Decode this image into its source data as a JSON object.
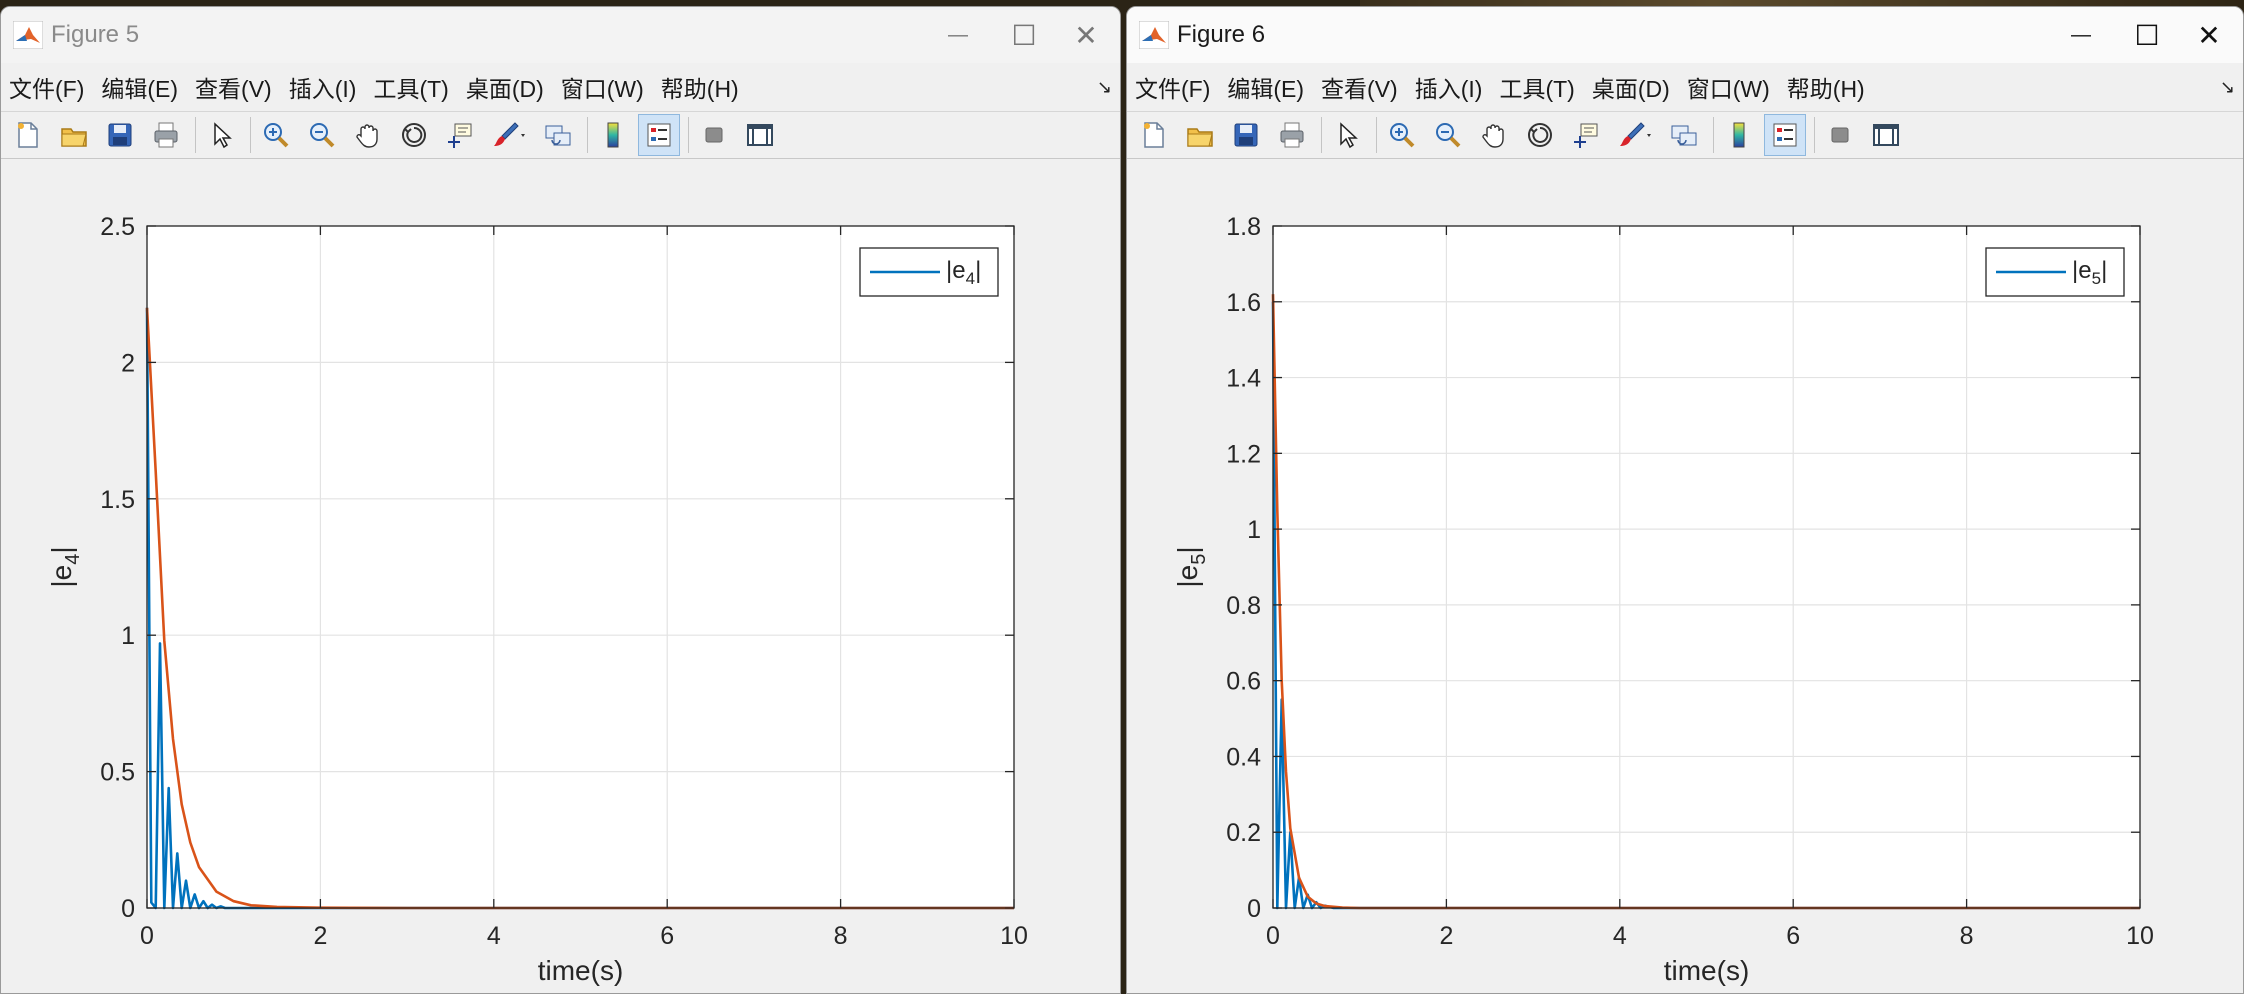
{
  "windows": [
    {
      "title": "Figure 5",
      "active": false,
      "menu": [
        "文件(F)",
        "编辑(E)",
        "查看(V)",
        "插入(I)",
        "工具(T)",
        "桌面(D)",
        "窗口(W)",
        "帮助(H)"
      ],
      "chart_data": {
        "type": "line",
        "xlabel": "time(s)",
        "ylabel_base": "|e",
        "ylabel_sub": "4",
        "ylabel_end": "|",
        "xlim": [
          0,
          10
        ],
        "ylim": [
          0,
          2.5
        ],
        "xticks": [
          0,
          2,
          4,
          6,
          8,
          10
        ],
        "yticks": [
          0,
          0.5,
          1,
          1.5,
          2,
          2.5
        ],
        "ytick_labels": [
          "0",
          "0.5",
          "1",
          "1.5",
          "2",
          "2.5"
        ],
        "grid": true,
        "legend": {
          "placement": "top-right",
          "base": "|e",
          "sub": "4",
          "end": "|"
        },
        "series": [
          {
            "legend_name": "|e4|",
            "color": "#0072BD",
            "kind": "oscillating-decay",
            "x": [
              0,
              0.05,
              0.1,
              0.15,
              0.2,
              0.25,
              0.3,
              0.35,
              0.4,
              0.45,
              0.5,
              0.55,
              0.6,
              0.65,
              0.7,
              0.75,
              0.8,
              0.85,
              0.9,
              1.0,
              1.2,
              1.5,
              2,
              10
            ],
            "y": [
              2.2,
              0.02,
              0.0,
              0.97,
              0.0,
              0.44,
              0.0,
              0.2,
              0.0,
              0.1,
              0.0,
              0.05,
              0.0,
              0.025,
              0.0,
              0.012,
              0.0,
              0.006,
              0.0,
              0.0,
              0.0,
              0.0,
              0.0,
              0.0
            ]
          },
          {
            "color": "#D95319",
            "kind": "envelope",
            "x": [
              0,
              0.1,
              0.2,
              0.3,
              0.4,
              0.5,
              0.6,
              0.8,
              1.0,
              1.2,
              1.5,
              2,
              3,
              10
            ],
            "y": [
              2.2,
              1.6,
              0.98,
              0.62,
              0.38,
              0.24,
              0.15,
              0.06,
              0.025,
              0.01,
              0.004,
              0.001,
              0.0,
              0.0
            ]
          }
        ]
      }
    },
    {
      "title": "Figure 6",
      "active": true,
      "menu": [
        "文件(F)",
        "编辑(E)",
        "查看(V)",
        "插入(I)",
        "工具(T)",
        "桌面(D)",
        "窗口(W)",
        "帮助(H)"
      ],
      "chart_data": {
        "type": "line",
        "xlabel": "time(s)",
        "ylabel_base": "|e",
        "ylabel_sub": "5",
        "ylabel_end": "|",
        "xlim": [
          0,
          10
        ],
        "ylim": [
          0,
          1.8
        ],
        "xticks": [
          0,
          2,
          4,
          6,
          8,
          10
        ],
        "yticks": [
          0,
          0.2,
          0.4,
          0.6,
          0.8,
          1,
          1.2,
          1.4,
          1.6,
          1.8
        ],
        "ytick_labels": [
          "0",
          "0.2",
          "0.4",
          "0.6",
          "0.8",
          "1",
          "1.2",
          "1.4",
          "1.6",
          "1.8"
        ],
        "grid": true,
        "legend": {
          "placement": "top-right",
          "base": "|e",
          "sub": "5",
          "end": "|"
        },
        "series": [
          {
            "legend_name": "|e5|",
            "color": "#0072BD",
            "kind": "oscillating-decay",
            "x": [
              0,
              0.05,
              0.1,
              0.15,
              0.2,
              0.25,
              0.3,
              0.35,
              0.4,
              0.45,
              0.5,
              0.55,
              0.6,
              0.7,
              0.8,
              1.0,
              2,
              10
            ],
            "y": [
              1.6,
              0.0,
              0.55,
              0.0,
              0.2,
              0.0,
              0.08,
              0.0,
              0.035,
              0.0,
              0.015,
              0.0,
              0.006,
              0.0,
              0.0,
              0.0,
              0.0,
              0.0
            ]
          },
          {
            "color": "#D95319",
            "kind": "envelope",
            "x": [
              0,
              0.05,
              0.1,
              0.15,
              0.2,
              0.3,
              0.4,
              0.5,
              0.6,
              0.8,
              1.0,
              1.5,
              2,
              10
            ],
            "y": [
              1.62,
              1.05,
              0.6,
              0.36,
              0.21,
              0.08,
              0.03,
              0.012,
              0.005,
              0.001,
              0.0,
              0.0,
              0.0,
              0.0
            ]
          }
        ]
      }
    }
  ],
  "window_controls": {
    "minimize": "—",
    "maximize": "☐",
    "close": "✕"
  },
  "menu_overflow": "↘",
  "toolbar_icons": [
    "new-file-icon",
    "open-folder-icon",
    "save-icon",
    "print-icon",
    "pointer-icon",
    "zoom-in-icon",
    "zoom-out-icon",
    "pan-hand-icon",
    "rotate-3d-icon",
    "data-cursor-icon",
    "brush-icon",
    "link-plot-icon",
    "colorbar-icon",
    "legend-icon",
    "hide-plot-tools-icon",
    "show-plot-tools-icon"
  ]
}
